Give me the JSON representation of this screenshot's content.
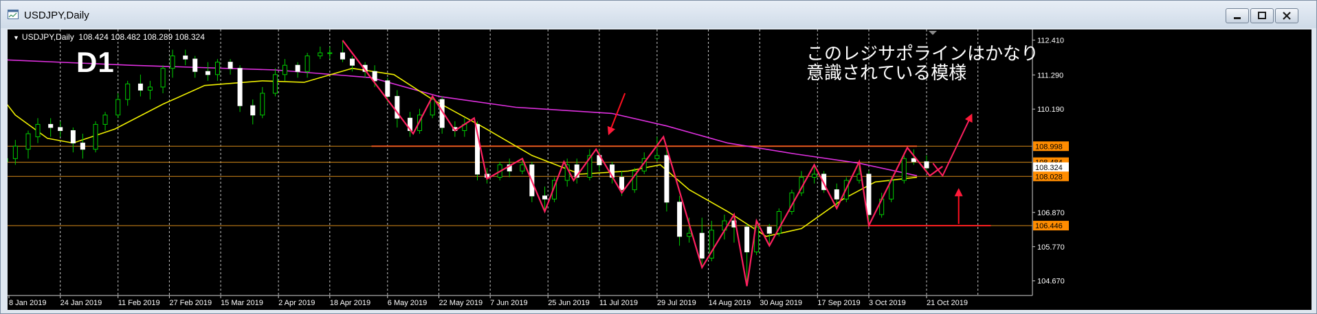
{
  "window": {
    "title": "USDJPY,Daily",
    "buttons": {
      "minimize": "minimize",
      "maximize": "maximize",
      "close": "close"
    }
  },
  "chart_data": {
    "type": "candlestick",
    "symbol": "USDJPY",
    "timeframe": "Daily",
    "ohlc_readout": "USDJPY,Daily  108.424 108.482 108.289 108.324",
    "timeframe_label": "D1",
    "annotation": {
      "line1": "このレジサポラインはかなり",
      "line2": "意識されている模様"
    },
    "ylim": [
      104.2,
      112.75
    ],
    "y_ticks": [
      "112.410",
      "111.290",
      "110.190",
      "106.870",
      "105.770",
      "104.670"
    ],
    "price_labels": [
      {
        "value": 108.998,
        "text": "108.998",
        "color": "#ff8c00",
        "text_color": "#000000"
      },
      {
        "value": 108.484,
        "text": "108.484",
        "color": "#ff8c00",
        "text_color": "#000000"
      },
      {
        "value": 108.324,
        "text": "108.324",
        "color": "#ffffff",
        "text_color": "#000000"
      },
      {
        "value": 108.028,
        "text": "108.028",
        "color": "#ff8c00",
        "text_color": "#000000"
      },
      {
        "value": 106.446,
        "text": "106.446",
        "color": "#ff8c00",
        "text_color": "#000000"
      }
    ],
    "x_labels": [
      {
        "date": "2019-01-08",
        "text": "8 Jan 2019"
      },
      {
        "date": "2019-01-24",
        "text": "24 Jan 2019"
      },
      {
        "date": "2019-02-11",
        "text": "11 Feb 2019"
      },
      {
        "date": "2019-02-27",
        "text": "27 Feb 2019"
      },
      {
        "date": "2019-03-15",
        "text": "15 Mar 2019"
      },
      {
        "date": "2019-04-02",
        "text": "2 Apr 2019"
      },
      {
        "date": "2019-04-18",
        "text": "18 Apr 2019"
      },
      {
        "date": "2019-05-06",
        "text": "6 May 2019"
      },
      {
        "date": "2019-05-22",
        "text": "22 May 2019"
      },
      {
        "date": "2019-06-07",
        "text": "7 Jun 2019"
      },
      {
        "date": "2019-06-25",
        "text": "25 Jun 2019"
      },
      {
        "date": "2019-07-11",
        "text": "11 Jul 2019"
      },
      {
        "date": "2019-07-29",
        "text": "29 Jul 2019"
      },
      {
        "date": "2019-08-14",
        "text": "14 Aug 2019"
      },
      {
        "date": "2019-08-30",
        "text": "30 Aug 2019"
      },
      {
        "date": "2019-09-17",
        "text": "17 Sep 2019"
      },
      {
        "date": "2019-10-03",
        "text": "3 Oct 2019"
      },
      {
        "date": "2019-10-21",
        "text": "21 Oct 2019"
      }
    ],
    "vertical_gridlines": [
      "2019-01-24",
      "2019-02-11",
      "2019-02-27",
      "2019-03-15",
      "2019-04-02",
      "2019-04-18",
      "2019-05-06",
      "2019-05-22",
      "2019-06-07",
      "2019-06-25",
      "2019-07-11",
      "2019-07-29",
      "2019-08-14",
      "2019-08-30",
      "2019-09-17",
      "2019-10-03",
      "2019-10-21",
      "2019-11-06"
    ],
    "horizontal_levels": [
      {
        "value": 108.998,
        "color": "#ff2020",
        "from": "2019-05-01",
        "to": "2019-10-18",
        "width": 2
      },
      {
        "value": 108.998,
        "color": "#d68a1a",
        "from": "2019-01-01",
        "to": "2019-11-28",
        "width": 1
      },
      {
        "value": 108.484,
        "color": "#d68a1a",
        "from": "2019-01-01",
        "to": "2019-11-28",
        "width": 1
      },
      {
        "value": 108.028,
        "color": "#d68a1a",
        "from": "2019-01-01",
        "to": "2019-11-28",
        "width": 1
      },
      {
        "value": 106.446,
        "color": "#d68a1a",
        "from": "2019-01-01",
        "to": "2019-11-28",
        "width": 1
      },
      {
        "value": 106.446,
        "color": "#ff2020",
        "from": "2019-10-03",
        "to": "2019-11-10",
        "width": 2
      }
    ],
    "series": [
      {
        "kind": "moving_average",
        "color": "#e030e0",
        "points": [
          [
            "2019-01-01",
            111.8
          ],
          [
            "2019-02-15",
            111.6
          ],
          [
            "2019-04-01",
            111.45
          ],
          [
            "2019-05-01",
            111.2
          ],
          [
            "2019-05-22",
            110.6
          ],
          [
            "2019-06-15",
            110.25
          ],
          [
            "2019-07-15",
            110.05
          ],
          [
            "2019-08-01",
            109.65
          ],
          [
            "2019-08-20",
            109.1
          ],
          [
            "2019-09-10",
            108.75
          ],
          [
            "2019-09-30",
            108.45
          ],
          [
            "2019-10-18",
            108.05
          ]
        ]
      },
      {
        "kind": "moving_average",
        "color": "#f0f000",
        "points": [
          [
            "2019-01-01",
            111.2
          ],
          [
            "2019-01-10",
            110.0
          ],
          [
            "2019-01-20",
            109.25
          ],
          [
            "2019-01-28",
            109.1
          ],
          [
            "2019-02-10",
            109.55
          ],
          [
            "2019-02-25",
            110.35
          ],
          [
            "2019-03-10",
            110.95
          ],
          [
            "2019-03-28",
            111.1
          ],
          [
            "2019-04-10",
            111.05
          ],
          [
            "2019-04-25",
            111.5
          ],
          [
            "2019-05-08",
            111.3
          ],
          [
            "2019-05-20",
            110.5
          ],
          [
            "2019-06-05",
            109.6
          ],
          [
            "2019-06-20",
            108.7
          ],
          [
            "2019-07-05",
            108.1
          ],
          [
            "2019-07-20",
            108.2
          ],
          [
            "2019-07-30",
            108.4
          ],
          [
            "2019-08-08",
            107.6
          ],
          [
            "2019-08-20",
            106.9
          ],
          [
            "2019-09-01",
            106.1
          ],
          [
            "2019-09-12",
            106.35
          ],
          [
            "2019-09-25",
            107.3
          ],
          [
            "2019-10-05",
            107.85
          ],
          [
            "2019-10-18",
            108.0
          ]
        ]
      }
    ],
    "candles": [
      [
        "2019-01-03",
        108.7,
        109.0,
        108.2,
        108.5
      ],
      [
        "2019-01-07",
        108.5,
        108.9,
        107.8,
        108.6
      ],
      [
        "2019-01-10",
        108.6,
        109.2,
        108.4,
        109.0
      ],
      [
        "2019-01-14",
        108.9,
        109.5,
        108.6,
        109.4
      ],
      [
        "2019-01-17",
        109.3,
        109.9,
        109.1,
        109.7
      ],
      [
        "2019-01-21",
        109.7,
        109.9,
        109.3,
        109.6
      ],
      [
        "2019-01-24",
        109.6,
        109.8,
        109.3,
        109.5
      ],
      [
        "2019-01-28",
        109.5,
        109.6,
        108.8,
        109.1
      ],
      [
        "2019-01-31",
        109.1,
        109.4,
        108.6,
        108.9
      ],
      [
        "2019-02-04",
        108.9,
        109.8,
        108.8,
        109.7
      ],
      [
        "2019-02-07",
        109.7,
        110.1,
        109.5,
        110.0
      ],
      [
        "2019-02-11",
        110.0,
        110.7,
        109.9,
        110.5
      ],
      [
        "2019-02-14",
        110.5,
        111.1,
        110.3,
        111.0
      ],
      [
        "2019-02-18",
        111.0,
        111.3,
        110.6,
        110.8
      ],
      [
        "2019-02-21",
        110.8,
        111.1,
        110.5,
        110.9
      ],
      [
        "2019-02-25",
        110.9,
        111.6,
        110.7,
        111.5
      ],
      [
        "2019-02-28",
        111.5,
        112.1,
        111.2,
        111.9
      ],
      [
        "2019-03-04",
        111.9,
        112.1,
        111.6,
        111.8
      ],
      [
        "2019-03-07",
        111.8,
        111.9,
        111.2,
        111.4
      ],
      [
        "2019-03-11",
        111.4,
        111.7,
        111.1,
        111.3
      ],
      [
        "2019-03-14",
        111.3,
        111.8,
        111.1,
        111.7
      ],
      [
        "2019-03-18",
        111.7,
        111.8,
        111.3,
        111.5
      ],
      [
        "2019-03-21",
        111.5,
        111.6,
        110.1,
        110.3
      ],
      [
        "2019-03-25",
        110.3,
        110.5,
        109.7,
        110.0
      ],
      [
        "2019-03-28",
        110.0,
        110.9,
        109.9,
        110.7
      ],
      [
        "2019-04-01",
        110.7,
        111.5,
        110.6,
        111.3
      ],
      [
        "2019-04-04",
        111.3,
        111.8,
        111.1,
        111.6
      ],
      [
        "2019-04-08",
        111.6,
        111.7,
        111.2,
        111.4
      ],
      [
        "2019-04-11",
        111.4,
        112.0,
        111.2,
        111.9
      ],
      [
        "2019-04-15",
        111.9,
        112.2,
        111.8,
        112.0
      ],
      [
        "2019-04-18",
        112.0,
        112.2,
        111.8,
        112.0
      ],
      [
        "2019-04-22",
        112.0,
        112.4,
        111.7,
        111.8
      ],
      [
        "2019-04-25",
        111.8,
        111.9,
        111.4,
        111.6
      ],
      [
        "2019-04-29",
        111.6,
        111.7,
        111.2,
        111.4
      ],
      [
        "2019-05-02",
        111.4,
        111.6,
        110.9,
        111.1
      ],
      [
        "2019-05-06",
        111.1,
        111.2,
        110.4,
        110.6
      ],
      [
        "2019-05-09",
        110.6,
        110.8,
        109.6,
        109.9
      ],
      [
        "2019-05-13",
        109.9,
        110.1,
        109.3,
        109.5
      ],
      [
        "2019-05-16",
        109.5,
        110.2,
        109.4,
        110.0
      ],
      [
        "2019-05-20",
        110.0,
        110.6,
        109.9,
        110.5
      ],
      [
        "2019-05-23",
        110.5,
        110.6,
        109.4,
        109.6
      ],
      [
        "2019-05-27",
        109.6,
        109.8,
        109.3,
        109.5
      ],
      [
        "2019-05-30",
        109.5,
        109.9,
        109.3,
        109.7
      ],
      [
        "2019-06-03",
        109.7,
        109.8,
        107.9,
        108.1
      ],
      [
        "2019-06-06",
        108.1,
        108.3,
        107.8,
        108.0
      ],
      [
        "2019-06-10",
        108.0,
        108.5,
        107.9,
        108.4
      ],
      [
        "2019-06-13",
        108.4,
        108.6,
        108.0,
        108.2
      ],
      [
        "2019-06-17",
        108.2,
        108.6,
        108.1,
        108.4
      ],
      [
        "2019-06-20",
        108.4,
        108.5,
        107.2,
        107.4
      ],
      [
        "2019-06-24",
        107.4,
        107.7,
        106.9,
        107.3
      ],
      [
        "2019-06-27",
        107.3,
        108.0,
        107.2,
        107.9
      ],
      [
        "2019-07-01",
        107.9,
        108.6,
        107.7,
        108.4
      ],
      [
        "2019-07-04",
        108.4,
        108.6,
        107.8,
        108.0
      ],
      [
        "2019-07-08",
        108.0,
        108.9,
        107.9,
        108.7
      ],
      [
        "2019-07-11",
        108.7,
        108.9,
        108.2,
        108.4
      ],
      [
        "2019-07-15",
        108.4,
        108.5,
        107.8,
        108.0
      ],
      [
        "2019-07-18",
        108.0,
        108.2,
        107.4,
        107.6
      ],
      [
        "2019-07-22",
        107.6,
        108.3,
        107.5,
        108.2
      ],
      [
        "2019-07-25",
        108.2,
        108.8,
        108.1,
        108.6
      ],
      [
        "2019-07-29",
        108.6,
        109.3,
        108.5,
        108.7
      ],
      [
        "2019-08-01",
        108.7,
        109.0,
        106.9,
        107.2
      ],
      [
        "2019-08-05",
        107.2,
        107.4,
        105.8,
        106.1
      ],
      [
        "2019-08-08",
        106.1,
        106.7,
        105.9,
        106.2
      ],
      [
        "2019-08-12",
        106.2,
        106.7,
        105.1,
        105.4
      ],
      [
        "2019-08-15",
        105.4,
        106.6,
        105.3,
        106.3
      ],
      [
        "2019-08-19",
        106.3,
        106.8,
        106.0,
        106.6
      ],
      [
        "2019-08-22",
        106.6,
        106.8,
        105.9,
        106.4
      ],
      [
        "2019-08-26",
        106.4,
        106.5,
        104.6,
        105.6
      ],
      [
        "2019-08-29",
        105.6,
        106.6,
        105.5,
        106.4
      ],
      [
        "2019-09-02",
        106.4,
        106.5,
        105.8,
        106.2
      ],
      [
        "2019-09-05",
        106.2,
        107.0,
        106.1,
        106.9
      ],
      [
        "2019-09-09",
        106.9,
        107.6,
        106.8,
        107.5
      ],
      [
        "2019-09-12",
        107.5,
        108.2,
        107.4,
        108.0
      ],
      [
        "2019-09-16",
        108.0,
        108.4,
        107.8,
        108.1
      ],
      [
        "2019-09-19",
        108.1,
        108.2,
        107.5,
        107.6
      ],
      [
        "2019-09-23",
        107.6,
        107.8,
        107.0,
        107.3
      ],
      [
        "2019-09-26",
        107.3,
        108.0,
        107.2,
        107.9
      ],
      [
        "2019-09-30",
        107.9,
        108.5,
        107.8,
        108.1
      ],
      [
        "2019-10-03",
        108.1,
        108.2,
        106.5,
        106.8
      ],
      [
        "2019-10-07",
        106.8,
        107.5,
        106.7,
        107.3
      ],
      [
        "2019-10-10",
        107.3,
        108.0,
        107.2,
        107.9
      ],
      [
        "2019-10-14",
        107.9,
        108.7,
        107.8,
        108.6
      ],
      [
        "2019-10-17",
        108.6,
        108.9,
        108.4,
        108.5
      ],
      [
        "2019-10-21",
        108.5,
        108.7,
        108.2,
        108.3
      ]
    ],
    "zigzag": [
      [
        "2019-04-22",
        112.4
      ],
      [
        "2019-05-14",
        109.4
      ],
      [
        "2019-05-20",
        110.6
      ],
      [
        "2019-05-27",
        109.5
      ],
      [
        "2019-06-02",
        109.9
      ],
      [
        "2019-06-06",
        107.95
      ],
      [
        "2019-06-17",
        108.6
      ],
      [
        "2019-06-24",
        106.9
      ],
      [
        "2019-06-30",
        108.5
      ],
      [
        "2019-07-03",
        107.9
      ],
      [
        "2019-07-10",
        108.9
      ],
      [
        "2019-07-18",
        107.5
      ],
      [
        "2019-07-31",
        109.3
      ],
      [
        "2019-08-12",
        105.1
      ],
      [
        "2019-08-22",
        106.8
      ],
      [
        "2019-08-26",
        104.5
      ],
      [
        "2019-08-29",
        106.6
      ],
      [
        "2019-09-02",
        105.8
      ],
      [
        "2019-09-16",
        108.4
      ],
      [
        "2019-09-23",
        107.0
      ],
      [
        "2019-09-30",
        108.5
      ],
      [
        "2019-10-03",
        106.45
      ],
      [
        "2019-10-15",
        108.95
      ],
      [
        "2019-10-22",
        108.05
      ],
      [
        "2019-10-26",
        108.35
      ]
    ],
    "projection_arrows": [
      {
        "from": [
          "2019-10-23",
          108.45
        ],
        "via": [
          "2019-10-26",
          108.05
        ],
        "to": [
          "2019-11-04",
          110.0
        ],
        "color": "#ff2060"
      },
      {
        "from": [
          "2019-10-31",
          106.5
        ],
        "to": [
          "2019-10-31",
          107.6
        ],
        "color": "#ff1020"
      },
      {
        "from": [
          "2019-07-14",
          109.4
        ],
        "to": [
          "2019-07-19",
          110.7
        ],
        "color": "#ff1020",
        "head": "start"
      }
    ]
  }
}
